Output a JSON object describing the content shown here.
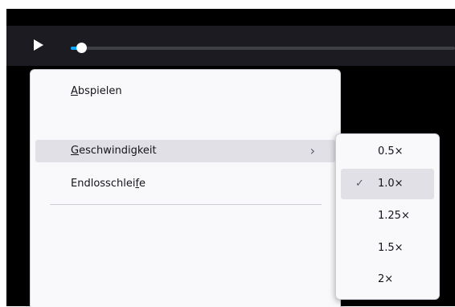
{
  "colors": {
    "accent": "#0aa8ff",
    "video_bg": "#000000",
    "controls_bg": "#1c1b22",
    "menu_bg": "#f9f9fb",
    "hover_bg": "#e0e0e6"
  },
  "player": {
    "play_icon": "play-icon",
    "progress_fraction": 0.02
  },
  "context_menu": {
    "items": [
      {
        "label": "Abspielen",
        "access_key": "A"
      },
      {
        "label": "Geschwindigkeit",
        "access_key": "G",
        "has_submenu": true,
        "highlighted": true
      },
      {
        "label": "Endlosschleife",
        "access_key": "f"
      }
    ],
    "submenu_icon": "chevron-right-icon"
  },
  "speed_submenu": {
    "options": [
      {
        "label": "0.5×",
        "checked": false
      },
      {
        "label": "1.0×",
        "checked": true
      },
      {
        "label": "1.25×",
        "checked": false
      },
      {
        "label": "1.5×",
        "checked": false
      },
      {
        "label": "2×",
        "checked": false
      }
    ],
    "check_icon": "checkmark-icon"
  }
}
